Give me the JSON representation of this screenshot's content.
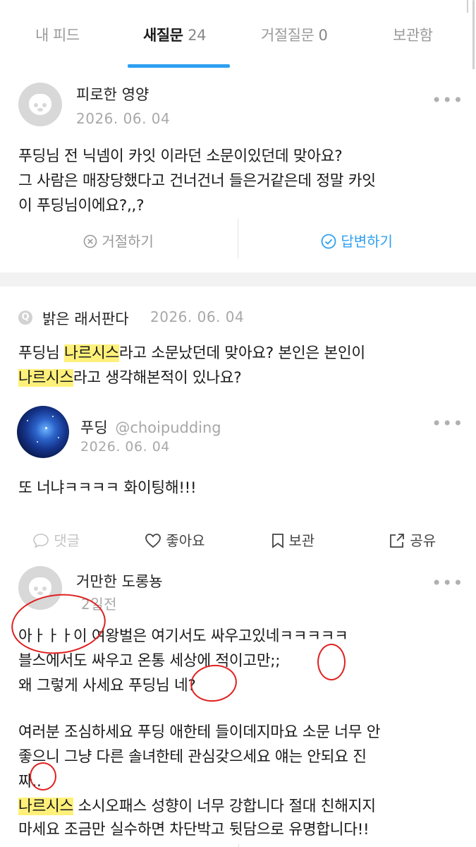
{
  "tabs": [
    {
      "label": "내 피드",
      "count": ""
    },
    {
      "label": "새질문",
      "count": "24"
    },
    {
      "label": "거절질문",
      "count": "0"
    },
    {
      "label": "보관함",
      "count": ""
    }
  ],
  "colors": {
    "accent": "#2ea0f0",
    "highlight": "#fff07a",
    "red_mark": "#e02020"
  },
  "question1": {
    "author": "피로한 영양",
    "date": "2026. 06. 04",
    "lines": [
      "푸딩님 전 닉넴이 카잇 이라던 소문이있던데 맞아요?",
      "그 사람은 매장당했다고 건너건너 들은거같은데 정말 카잇",
      "이 푸딩님이에요?,,?"
    ],
    "reject_label": "거절하기",
    "answer_label": "답변하기"
  },
  "question2": {
    "q_badge": "Q",
    "author": "밝은 래서판다",
    "date": "2026. 06. 04",
    "line1_before": "푸딩님 ",
    "line1_hl": "나르시스",
    "line1_after": "라고 소문났던데 맞아요? 본인은 본인이",
    "line2_hl": "나르시스",
    "line2_after": "라고 생각해본적이 있나요?"
  },
  "answer": {
    "author": "푸딩",
    "handle": "@choipudding",
    "date": "2026. 06. 04",
    "text": "또 너냐ㅋㅋㅋㅋ 화이팅해!!!"
  },
  "footer": {
    "comment": "댓글",
    "like": "좋아요",
    "bookmark": "보관",
    "share": "공유"
  },
  "question3": {
    "author": "거만한 도롱뇽",
    "date": "2일전",
    "lines": [
      "아ㅏㅏㅏ이 여왕벌은 여기서도 싸우고있네ㅋㅋㅋㅋㅋ",
      "블스에서도 싸우고 온통 세상에 적이고만;;",
      "왜 그렇게 사세요 푸딩님 네?",
      "여러분 조심하세요 푸딩 애한테 들이데지마요 소문 너무 안",
      "좋으니 그냥 다른 솔녀한테 관심갖으세요 얘는 안되요 진",
      "짜.."
    ],
    "line7_hl": "나르시스",
    "line7_after": " 소시오패스 성향이 너무 강합니다 절대 친해지지",
    "line8": "마세요 조금만 실수하면 차단박고 뒷담으로 유명합니다!!"
  },
  "more_icon": "•••"
}
